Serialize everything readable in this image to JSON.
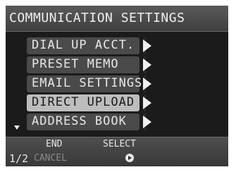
{
  "title": "COMMUNICATION SETTINGS",
  "menu": {
    "items": [
      {
        "label": "DIAL UP ACCT."
      },
      {
        "label": "PRESET MEMO"
      },
      {
        "label": "EMAIL SETTINGS"
      },
      {
        "label": "DIRECT UPLOAD",
        "selected": true
      },
      {
        "label": "ADDRESS BOOK"
      }
    ]
  },
  "footer": {
    "page": "1/2",
    "end_label": "END",
    "cancel_label": "CANCEL",
    "select_label": "SELECT"
  },
  "icons": {
    "more": "triangle-down-icon",
    "submenu": "triangle-right-icon",
    "ok": "ok-button-icon"
  },
  "colors": {
    "background": "#1b1b1b",
    "highlight": "#bdbdbd"
  }
}
